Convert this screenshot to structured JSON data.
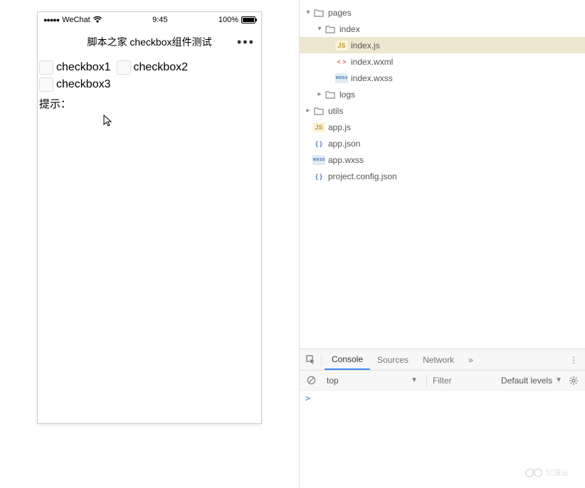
{
  "simulator": {
    "statusBar": {
      "carrier": "WeChat",
      "time": "9:45",
      "batteryPct": "100%"
    },
    "navBar": {
      "title": "脚本之家 checkbox组件测试",
      "moreGlyph": "•••"
    },
    "page": {
      "checkboxes": [
        "checkbox1",
        "checkbox2",
        "checkbox3"
      ],
      "tipLabel": "提示："
    }
  },
  "fileTree": [
    {
      "depth": 0,
      "type": "folder",
      "open": true,
      "name": "pages"
    },
    {
      "depth": 1,
      "type": "folder",
      "open": true,
      "name": "index"
    },
    {
      "depth": 2,
      "type": "js",
      "name": "index.js",
      "selected": true
    },
    {
      "depth": 2,
      "type": "wxml",
      "name": "index.wxml"
    },
    {
      "depth": 2,
      "type": "wxss",
      "name": "index.wxss"
    },
    {
      "depth": 1,
      "type": "folder",
      "open": false,
      "name": "logs"
    },
    {
      "depth": 0,
      "type": "folder",
      "open": false,
      "name": "utils"
    },
    {
      "depth": 0,
      "type": "js",
      "name": "app.js"
    },
    {
      "depth": 0,
      "type": "json",
      "name": "app.json"
    },
    {
      "depth": 0,
      "type": "wxss",
      "name": "app.wxss"
    },
    {
      "depth": 0,
      "type": "json",
      "name": "project.config.json"
    }
  ],
  "fileIcons": {
    "folder": "📁",
    "js": "JS",
    "wxml": "< >",
    "wxss": "wxss",
    "json": "{ }"
  },
  "devtools": {
    "tabs": [
      "Console",
      "Sources",
      "Network"
    ],
    "activeTab": "Console",
    "overflowGlyph": "»",
    "moreGlyph": "⋮",
    "toolbar": {
      "context": "top",
      "filterPlaceholder": "Filter",
      "levels": "Default levels"
    },
    "console": {
      "prompt": ">"
    }
  },
  "watermarkLabel": "亿速云"
}
